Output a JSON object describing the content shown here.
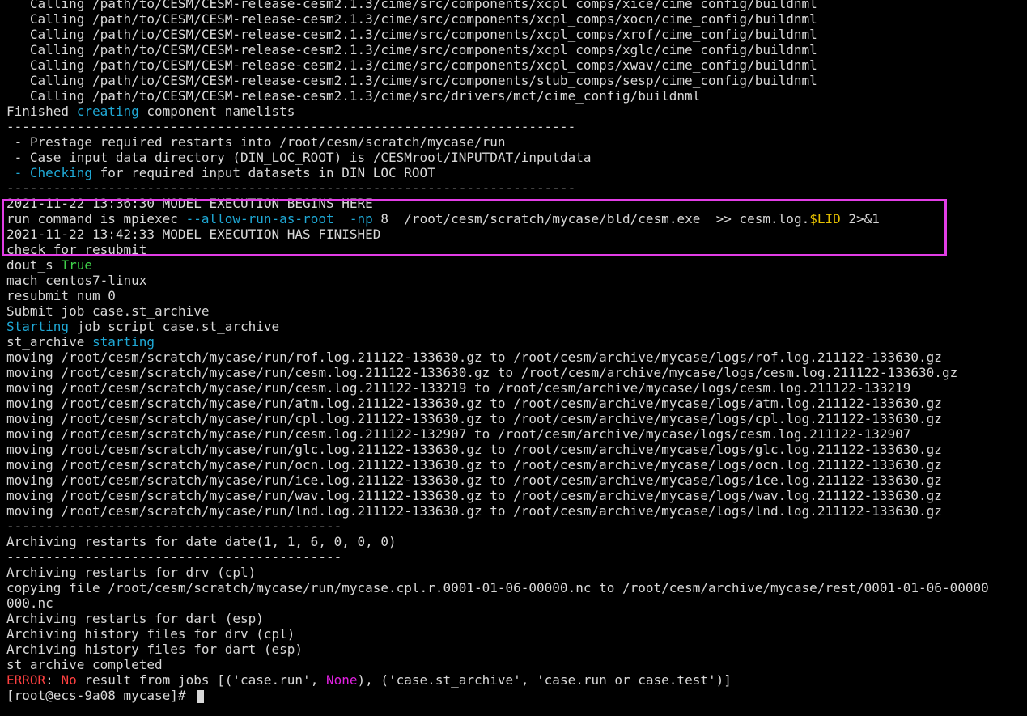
{
  "colors": {
    "background": "#000000",
    "text": "#d8d8d8",
    "cyan": "#1fa9d6",
    "green": "#3fd24a",
    "yellow": "#e6c100",
    "red": "#ff4040",
    "magenta": "#e020e0",
    "highlight_border": "#e23ee6"
  },
  "terminal": {
    "lines": [
      [
        {
          "t": "   Calling /path/to/CESM/CESM-release-cesm2.1.3/cime/src/components/xcpl_comps/xice/cime_config/buildnml"
        }
      ],
      [
        {
          "t": "   Calling /path/to/CESM/CESM-release-cesm2.1.3/cime/src/components/xcpl_comps/xocn/cime_config/buildnml"
        }
      ],
      [
        {
          "t": "   Calling /path/to/CESM/CESM-release-cesm2.1.3/cime/src/components/xcpl_comps/xrof/cime_config/buildnml"
        }
      ],
      [
        {
          "t": "   Calling /path/to/CESM/CESM-release-cesm2.1.3/cime/src/components/xcpl_comps/xglc/cime_config/buildnml"
        }
      ],
      [
        {
          "t": "   Calling /path/to/CESM/CESM-release-cesm2.1.3/cime/src/components/xcpl_comps/xwav/cime_config/buildnml"
        }
      ],
      [
        {
          "t": "   Calling /path/to/CESM/CESM-release-cesm2.1.3/cime/src/components/stub_comps/sesp/cime_config/buildnml"
        }
      ],
      [
        {
          "t": "   Calling /path/to/CESM/CESM-release-cesm2.1.3/cime/src/drivers/mct/cime_config/buildnml"
        }
      ],
      [
        {
          "t": "Finished "
        },
        {
          "t": "creating",
          "c": "cyan"
        },
        {
          "t": " component namelists"
        }
      ],
      [
        {
          "t": "-------------------------------------------------------------------------"
        }
      ],
      [
        {
          "t": " - Prestage required restarts into /root/cesm/scratch/mycase/run"
        }
      ],
      [
        {
          "t": " - Case input data directory (DIN_LOC_ROOT) is /CESMroot/INPUTDAT/inputdata"
        }
      ],
      [
        {
          "t": " - ",
          "c": "cyan"
        },
        {
          "t": "Checking",
          "c": "cyan"
        },
        {
          "t": " for required input datasets in DIN_LOC_ROOT"
        }
      ],
      [
        {
          "t": "-------------------------------------------------------------------------"
        }
      ],
      [
        {
          "t": "2021-11-22 13:36:30 MODEL EXECUTION BEGINS HERE"
        }
      ],
      [
        {
          "t": "run command is mpiexec "
        },
        {
          "t": "--allow-run-as-root",
          "c": "cyan"
        },
        {
          "t": "  "
        },
        {
          "t": "-np",
          "c": "cyan"
        },
        {
          "t": " 8  /root/cesm/scratch/mycase/bld/cesm.exe  >> cesm.log."
        },
        {
          "t": "$LID",
          "c": "yellow"
        },
        {
          "t": " 2>&1"
        }
      ],
      [
        {
          "t": "2021-11-22 13:42:33 MODEL EXECUTION HAS FINISHED"
        }
      ],
      [
        {
          "t": "check for resubmit"
        }
      ],
      [
        {
          "t": "dout_s "
        },
        {
          "t": "True",
          "c": "green"
        }
      ],
      [
        {
          "t": "mach centos7-linux"
        }
      ],
      [
        {
          "t": "resubmit_num 0"
        }
      ],
      [
        {
          "t": "Submit job case.st_archive"
        }
      ],
      [
        {
          "t": "Starting",
          "c": "cyan"
        },
        {
          "t": " job script case.st_archive"
        }
      ],
      [
        {
          "t": "st_archive "
        },
        {
          "t": "starting",
          "c": "cyan"
        }
      ],
      [
        {
          "t": "moving /root/cesm/scratch/mycase/run/rof.log.211122-133630.gz to /root/cesm/archive/mycase/logs/rof.log.211122-133630.gz"
        }
      ],
      [
        {
          "t": "moving /root/cesm/scratch/mycase/run/cesm.log.211122-133630.gz to /root/cesm/archive/mycase/logs/cesm.log.211122-133630.gz"
        }
      ],
      [
        {
          "t": "moving /root/cesm/scratch/mycase/run/cesm.log.211122-133219 to /root/cesm/archive/mycase/logs/cesm.log.211122-133219"
        }
      ],
      [
        {
          "t": "moving /root/cesm/scratch/mycase/run/atm.log.211122-133630.gz to /root/cesm/archive/mycase/logs/atm.log.211122-133630.gz"
        }
      ],
      [
        {
          "t": "moving /root/cesm/scratch/mycase/run/cpl.log.211122-133630.gz to /root/cesm/archive/mycase/logs/cpl.log.211122-133630.gz"
        }
      ],
      [
        {
          "t": "moving /root/cesm/scratch/mycase/run/cesm.log.211122-132907 to /root/cesm/archive/mycase/logs/cesm.log.211122-132907"
        }
      ],
      [
        {
          "t": "moving /root/cesm/scratch/mycase/run/glc.log.211122-133630.gz to /root/cesm/archive/mycase/logs/glc.log.211122-133630.gz"
        }
      ],
      [
        {
          "t": "moving /root/cesm/scratch/mycase/run/ocn.log.211122-133630.gz to /root/cesm/archive/mycase/logs/ocn.log.211122-133630.gz"
        }
      ],
      [
        {
          "t": "moving /root/cesm/scratch/mycase/run/ice.log.211122-133630.gz to /root/cesm/archive/mycase/logs/ice.log.211122-133630.gz"
        }
      ],
      [
        {
          "t": "moving /root/cesm/scratch/mycase/run/wav.log.211122-133630.gz to /root/cesm/archive/mycase/logs/wav.log.211122-133630.gz"
        }
      ],
      [
        {
          "t": "moving /root/cesm/scratch/mycase/run/lnd.log.211122-133630.gz to /root/cesm/archive/mycase/logs/lnd.log.211122-133630.gz"
        }
      ],
      [
        {
          "t": "-------------------------------------------"
        }
      ],
      [
        {
          "t": "Archiving restarts for date date(1, 1, 6, 0, 0, 0)"
        }
      ],
      [
        {
          "t": "-------------------------------------------"
        }
      ],
      [
        {
          "t": "Archiving restarts for drv (cpl)"
        }
      ],
      [
        {
          "t": "copying file /root/cesm/scratch/mycase/run/mycase.cpl.r.0001-01-06-00000.nc to /root/cesm/archive/mycase/rest/0001-01-06-00000"
        }
      ],
      [
        {
          "t": "000.nc"
        }
      ],
      [
        {
          "t": "Archiving restarts for dart (esp)"
        }
      ],
      [
        {
          "t": "Archiving history files for drv (cpl)"
        }
      ],
      [
        {
          "t": "Archiving history files for dart (esp)"
        }
      ],
      [
        {
          "t": "st_archive completed"
        }
      ],
      [
        {
          "t": "ERROR",
          "c": "red"
        },
        {
          "t": ": "
        },
        {
          "t": "No",
          "c": "red"
        },
        {
          "t": " result from jobs [('case.run', "
        },
        {
          "t": "None",
          "c": "magenta"
        },
        {
          "t": "), ('case.st_archive', 'case.run or case.test')]"
        }
      ],
      [
        {
          "t": "[root@ecs-9a08 mycase]# "
        }
      ]
    ]
  }
}
